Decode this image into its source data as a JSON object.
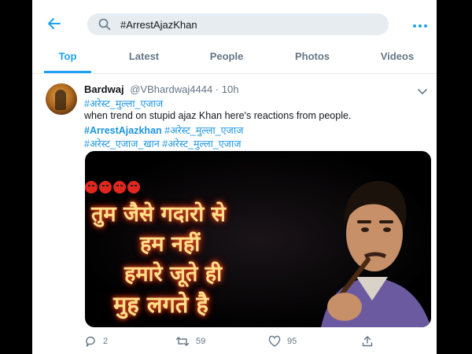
{
  "search": {
    "value": "#ArrestAjazKhan"
  },
  "tabs": [
    {
      "label": "Top",
      "active": true
    },
    {
      "label": "Latest",
      "active": false
    },
    {
      "label": "People",
      "active": false
    },
    {
      "label": "Photos",
      "active": false
    },
    {
      "label": "Videos",
      "active": false
    }
  ],
  "tweet": {
    "name": "Bardwaj",
    "handle": "@VBhardwaj4444 · 10h",
    "line1": "#अरेस्ट_मुल्ला_एजाज",
    "line2": " when trend on stupid ajaz Khan here's reactions from people.",
    "line3_tag_bold": "#ArrestAjazkhan",
    "line3_tag": "#अरेस्ट_मुल्ला_एजाज",
    "line4_tag_a": "#अरेस्ट_एजाज_खान",
    "line4_tag_b": "#अरेस्ट_मुल्ला_एजाज",
    "media_lines": [
      "तुम जैसे गदारो से",
      "हम नहीं",
      "हमारे जूते ही",
      "मुह लगते है"
    ],
    "reply_count": "2",
    "retweet_count": "59",
    "like_count": "95"
  },
  "icons": [
    "back-arrow-icon",
    "search-icon",
    "more-dots-icon",
    "chevron-down-icon",
    "reply-icon",
    "retweet-icon",
    "like-icon",
    "share-icon"
  ],
  "colors": {
    "accent": "#1da1f2",
    "link": "#1b95e0",
    "muted": "#657786",
    "background": "#000000"
  }
}
